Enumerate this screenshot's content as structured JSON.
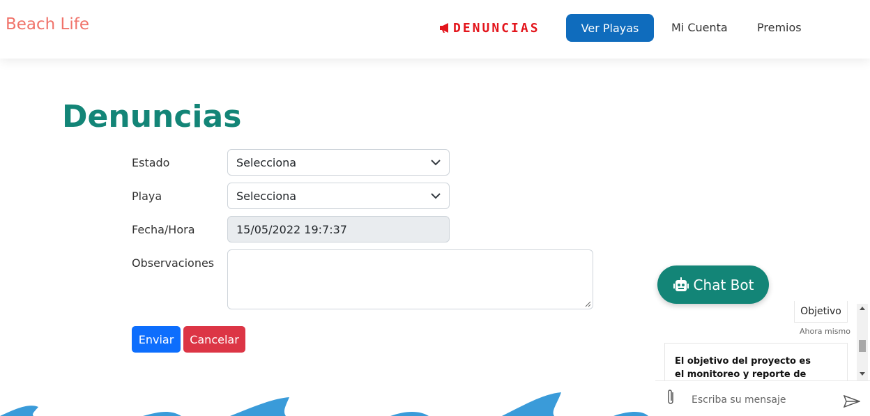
{
  "navbar": {
    "brand": "Beach Life",
    "denuncias": "DENUNCIAS",
    "ver_playas": "Ver Playas",
    "mi_cuenta": "Mi Cuenta",
    "premios": "Premios"
  },
  "page": {
    "title": "Denuncias"
  },
  "form": {
    "estado_label": "Estado",
    "estado_value": "Selecciona",
    "playa_label": "Playa",
    "playa_value": "Selecciona",
    "fecha_label": "Fecha/Hora",
    "fecha_value": "15/05/2022 19:7:37",
    "observaciones_label": "Observaciones",
    "enviar": "Enviar",
    "cancelar": "Cancelar"
  },
  "chat": {
    "toggle_label": "Chat Bot",
    "user_message": "Objetivo",
    "time": "Ahora mismo",
    "bot_message_line1": "El objetivo del proyecto es",
    "bot_message_line2": "el monitoreo y reporte de indicios",
    "placeholder": "Escriba su mensaje"
  },
  "colors": {
    "brand": "#f0736a",
    "accent_teal": "#138577",
    "nav_button": "#0f6cbd",
    "denuncias_red": "#e3151c",
    "primary": "#0d6efd",
    "danger": "#dc3545"
  }
}
